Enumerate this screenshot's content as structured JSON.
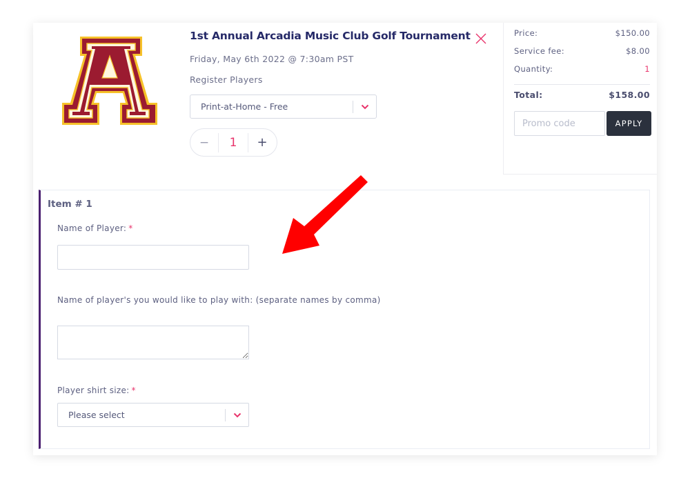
{
  "event": {
    "title": "1st Annual Arcadia Music Club Golf Tournament",
    "date": "Friday, May 6th 2022 @ 7:30am PST",
    "subtitle": "Register Players",
    "logo_letter": "A",
    "ticket_type": {
      "selected": "Print-at-Home - Free",
      "icon": "chevron-down-icon"
    },
    "quantity": {
      "value": "1",
      "minus": "−",
      "plus": "+"
    },
    "close_icon": "close-icon"
  },
  "summary": {
    "price_label": "Price:",
    "price_value": "$150.00",
    "fee_label": "Service fee:",
    "fee_value": "$8.00",
    "quantity_label": "Quantity:",
    "quantity_value": "1",
    "total_label": "Total:",
    "total_value": "$158.00",
    "promo_placeholder": "Promo code",
    "promo_value": "",
    "apply_label": "APPLY"
  },
  "item": {
    "title": "Item # 1",
    "fields": [
      {
        "label": "Name of Player:",
        "required": "*",
        "value": ""
      },
      {
        "label": "Name of player's you would like to play with: (separate names by comma)",
        "required": "",
        "value": ""
      },
      {
        "label": "Player shirt size:",
        "required": "*",
        "selected": "Please select"
      }
    ]
  },
  "annotation": {
    "icon": "red-arrow-icon",
    "color": "#ff0000"
  },
  "colors": {
    "accent_pink": "#e8336b",
    "title_navy": "#262a68",
    "panel_purple": "#4b2070",
    "apply_dark": "#2b313d",
    "logo_maroon": "#9b1b30",
    "logo_gold": "#f6c12a"
  }
}
